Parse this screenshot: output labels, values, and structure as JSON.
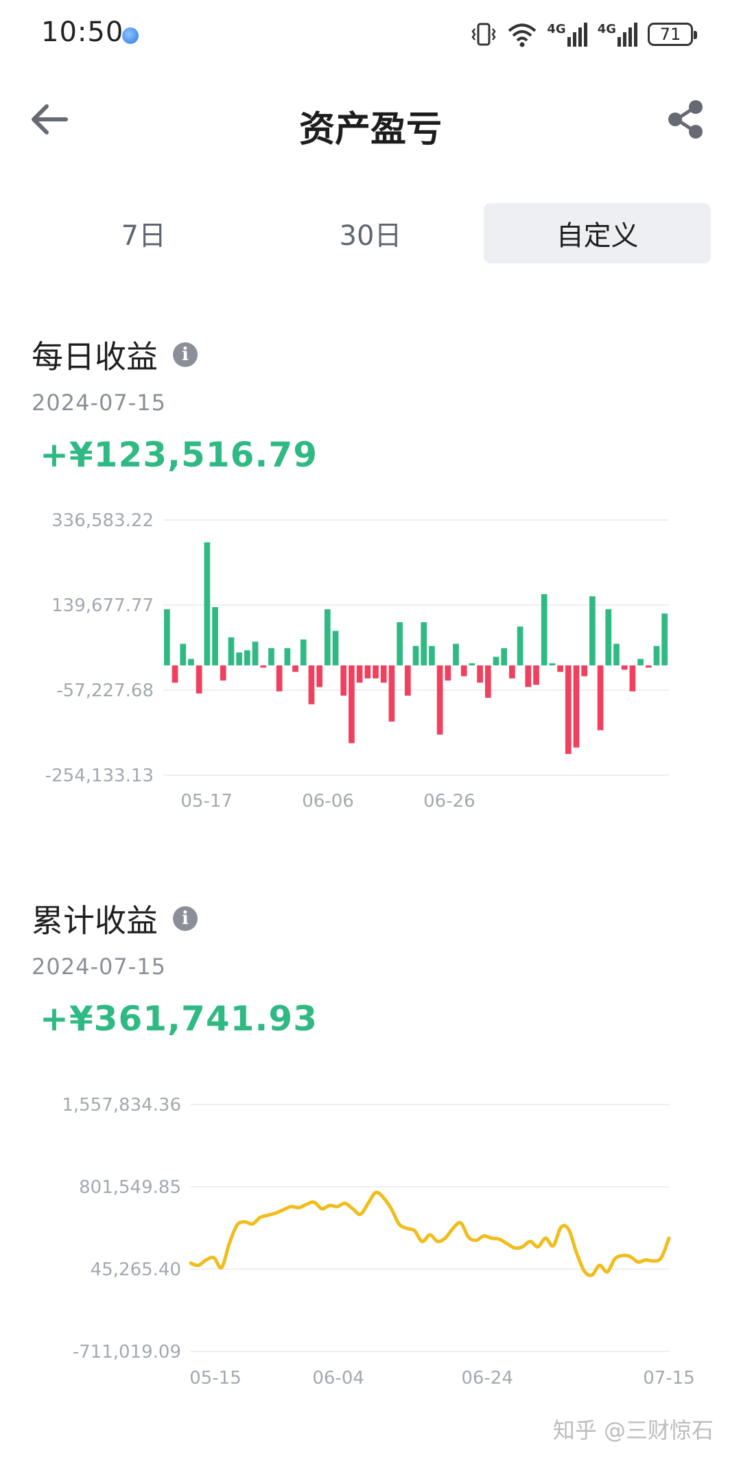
{
  "status_bar": {
    "time": "10:50",
    "battery": "71",
    "network_1": "4G",
    "network_2": "4G"
  },
  "header": {
    "title": "资产盈亏",
    "back_icon": "arrow-left-icon",
    "share_icon": "share-icon"
  },
  "tabs": [
    {
      "label": "7日",
      "active": false
    },
    {
      "label": "30日",
      "active": false
    },
    {
      "label": "自定义",
      "active": true
    }
  ],
  "daily": {
    "title": "每日收益",
    "info_icon": "info-icon",
    "date": "2024-07-15",
    "amount": "+¥123,516.79",
    "colors": {
      "positive": "#2fb983",
      "negative": "#f0405e"
    }
  },
  "cumulative": {
    "title": "累计收益",
    "info_icon": "info-icon",
    "date": "2024-07-15",
    "amount": "+¥361,741.93",
    "color": "#f0bd1a"
  },
  "watermark": "知乎 @三财惊石",
  "chart_data": [
    {
      "type": "bar",
      "title": "每日收益",
      "ytick_labels": [
        "336,583.22",
        "139,677.77",
        "-57,227.68",
        "-254,133.13"
      ],
      "ylim": [
        -254133.13,
        336583.22
      ],
      "xtick_labels": [
        "05-17",
        "06-06",
        "06-26"
      ],
      "grid": true,
      "values": [
        130000,
        -40000,
        50000,
        15000,
        -65000,
        285000,
        135000,
        -35000,
        65000,
        30000,
        35000,
        55000,
        -5000,
        40000,
        -60000,
        40000,
        -15000,
        60000,
        -90000,
        -50000,
        130000,
        80000,
        -70000,
        -180000,
        -40000,
        -30000,
        -30000,
        -40000,
        -130000,
        100000,
        -70000,
        45000,
        100000,
        45000,
        -160000,
        -35000,
        50000,
        -25000,
        5000,
        -40000,
        -75000,
        20000,
        40000,
        -30000,
        90000,
        -50000,
        -45000,
        165000,
        5000,
        -15000,
        -205000,
        -190000,
        -25000,
        160000,
        -150000,
        130000,
        50000,
        -10000,
        -60000,
        15000,
        -5000,
        45000,
        120000
      ],
      "negative_color": "#f0405e",
      "positive_color": "#2fb983"
    },
    {
      "type": "line",
      "title": "累计收益",
      "ytick_labels": [
        "1,557,834.36",
        "801,549.85",
        "45,265.40",
        "-711,019.09"
      ],
      "ylim": [
        -711019.09,
        1557834.36
      ],
      "xtick_labels": [
        "05-15",
        "06-04",
        "06-24",
        "07-15"
      ],
      "grid": true,
      "series": [
        {
          "color": "#f0bd1a",
          "values": [
            100000,
            80000,
            130000,
            150000,
            60000,
            280000,
            450000,
            480000,
            460000,
            520000,
            540000,
            560000,
            590000,
            620000,
            610000,
            640000,
            660000,
            600000,
            630000,
            620000,
            650000,
            600000,
            550000,
            650000,
            750000,
            700000,
            600000,
            460000,
            420000,
            400000,
            300000,
            360000,
            300000,
            330000,
            420000,
            470000,
            340000,
            310000,
            350000,
            330000,
            320000,
            280000,
            240000,
            250000,
            300000,
            250000,
            330000,
            260000,
            430000,
            410000,
            200000,
            30000,
            -10000,
            80000,
            20000,
            140000,
            170000,
            160000,
            110000,
            130000,
            120000,
            150000,
            330000
          ]
        }
      ]
    }
  ]
}
